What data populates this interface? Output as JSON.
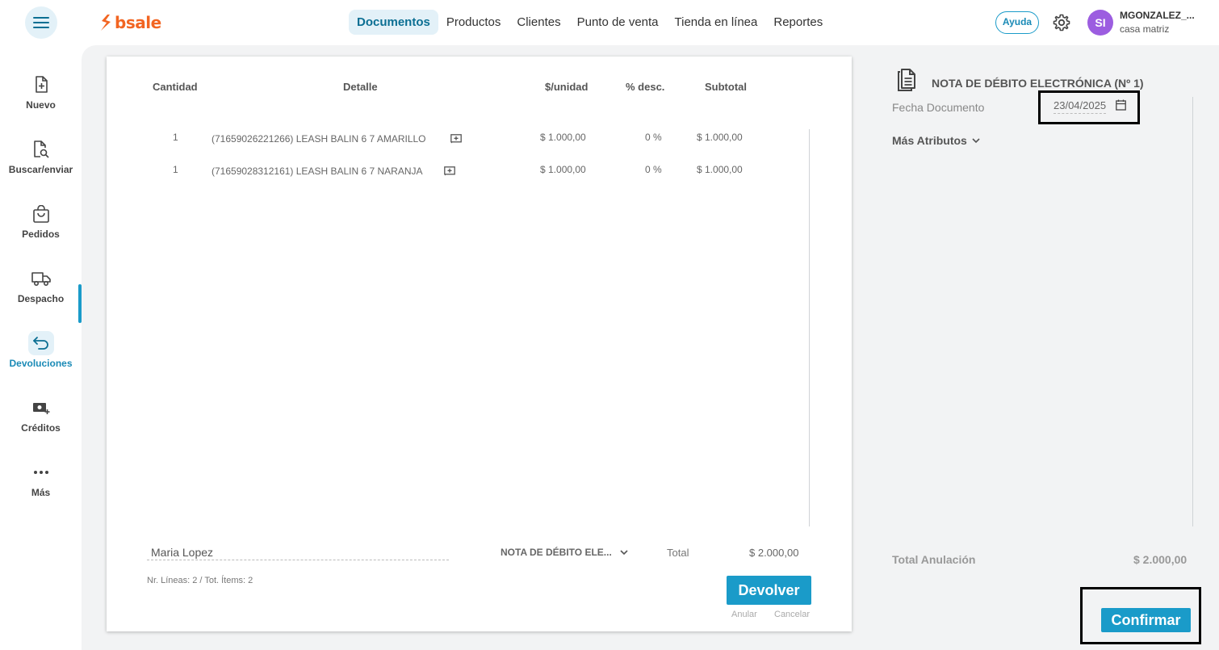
{
  "header": {
    "logo_text": "bsale",
    "nav": [
      "Documentos",
      "Productos",
      "Clientes",
      "Punto de venta",
      "Tienda en línea",
      "Reportes"
    ],
    "help": "Ayuda",
    "avatar_initials": "SI",
    "user_name": "MGONZALEZ_...",
    "user_branch": "casa matriz",
    "accent": "#1a9bc9",
    "brand": "#f26522"
  },
  "sidebar": {
    "items": [
      {
        "label": "Nuevo",
        "icon": "file-plus-icon"
      },
      {
        "label": "Buscar/enviar",
        "icon": "file-search-icon"
      },
      {
        "label": "Pedidos",
        "icon": "shopping-bag-icon"
      },
      {
        "label": "Despacho",
        "icon": "truck-icon"
      },
      {
        "label": "Devoluciones",
        "icon": "return-arrow-icon"
      },
      {
        "label": "Créditos",
        "icon": "money-plus-icon"
      },
      {
        "label": "Más",
        "icon": "more-dots-icon"
      }
    ],
    "active": "Devoluciones"
  },
  "table": {
    "headers": {
      "qty": "Cantidad",
      "detail": "Detalle",
      "unit": "$/unidad",
      "disc": "% desc.",
      "subtotal": "Subtotal"
    },
    "rows": [
      {
        "qty": "1",
        "detail": "(71659026221266) LEASH BALIN 6 7 AMARILLO",
        "unit": "$ 1.000,00",
        "disc": "0 %",
        "subtotal": "$ 1.000,00"
      },
      {
        "qty": "1",
        "detail": "(71659028312161) LEASH BALIN 6 7 NARANJA",
        "unit": "$ 1.000,00",
        "disc": "0 %",
        "subtotal": "$ 1.000,00"
      }
    ]
  },
  "footer": {
    "signer": "Maria Lopez",
    "doc_type": "NOTA DE DÉBITO ELE...",
    "total_label": "Total",
    "total_value": "$ 2.000,00",
    "lines_info": "Nr. Líneas: 2 / Tot. Ítems: 2",
    "devolver": "Devolver",
    "anular": "Anular",
    "cancelar": "Cancelar"
  },
  "right": {
    "title": "NOTA DE DÉBITO ELECTRÓNICA (Nº 1)",
    "fecha_label": "Fecha Documento",
    "fecha_value": "23/04/2025",
    "mas_atributos": "Más Atributos",
    "total_anulacion_label": "Total Anulación",
    "total_anulacion_value": "$ 2.000,00",
    "confirmar": "Confirmar"
  }
}
